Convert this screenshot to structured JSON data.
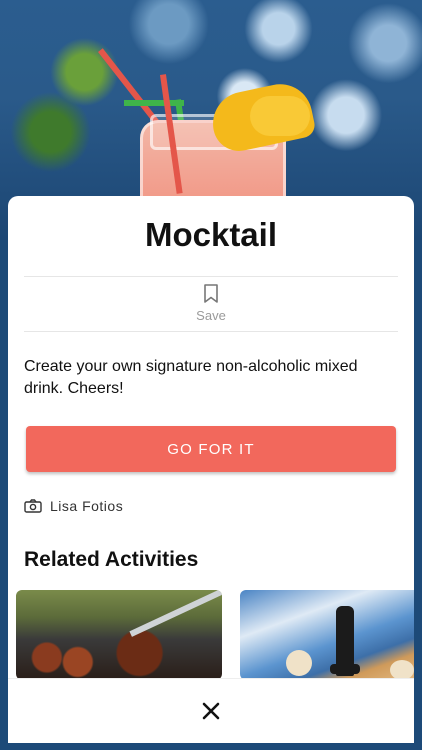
{
  "activity": {
    "title": "Mocktail",
    "save_label": "Save",
    "description": "Create your own signature non-alcoholic mixed drink. Cheers!",
    "cta_label": "GO FOR IT",
    "photo_credit": "Lisa Fotios"
  },
  "related": {
    "heading": "Related Activities"
  },
  "icons": {
    "save": "bookmark-icon",
    "credit": "camera-icon",
    "close": "close-icon"
  },
  "colors": {
    "accent": "#f2685c",
    "backdrop": "#1d4a78"
  }
}
